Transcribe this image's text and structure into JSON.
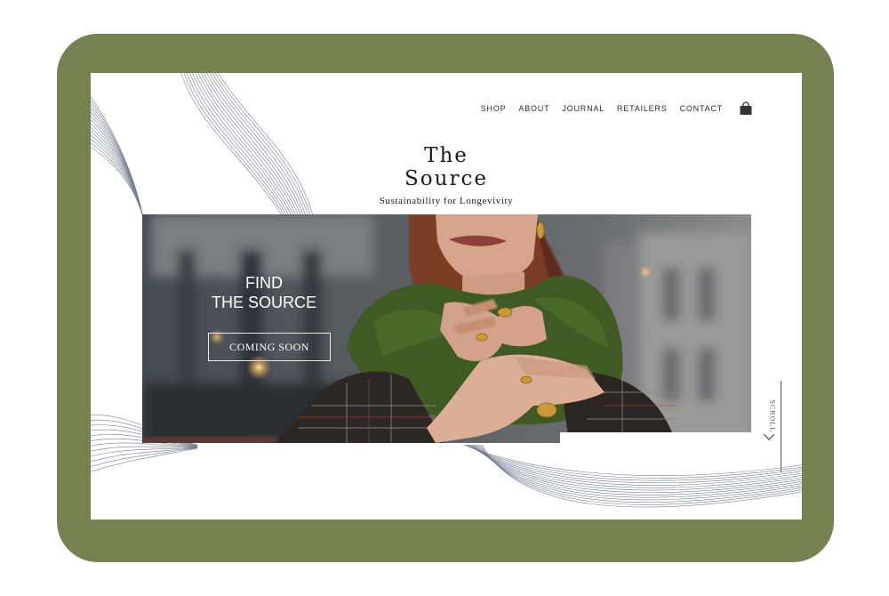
{
  "nav": {
    "items": [
      "SHOP",
      "ABOUT",
      "JOURNAL",
      "RETAILERS",
      "CONTACT"
    ],
    "bag_icon": "shopping-bag-icon"
  },
  "brand": {
    "line1": "The",
    "line2": "Source",
    "tagline": "Sustainability for Longevivity"
  },
  "hero": {
    "heading_line1": "FIND",
    "heading_line2": "THE SOURCE",
    "cta_label": "COMING SOON"
  },
  "scroll": {
    "label": "SCROLL",
    "icon": "chevron-down-icon"
  },
  "colors": {
    "frame": "#758150",
    "scarf": "#3f5a22",
    "screen": "#ffffff"
  }
}
